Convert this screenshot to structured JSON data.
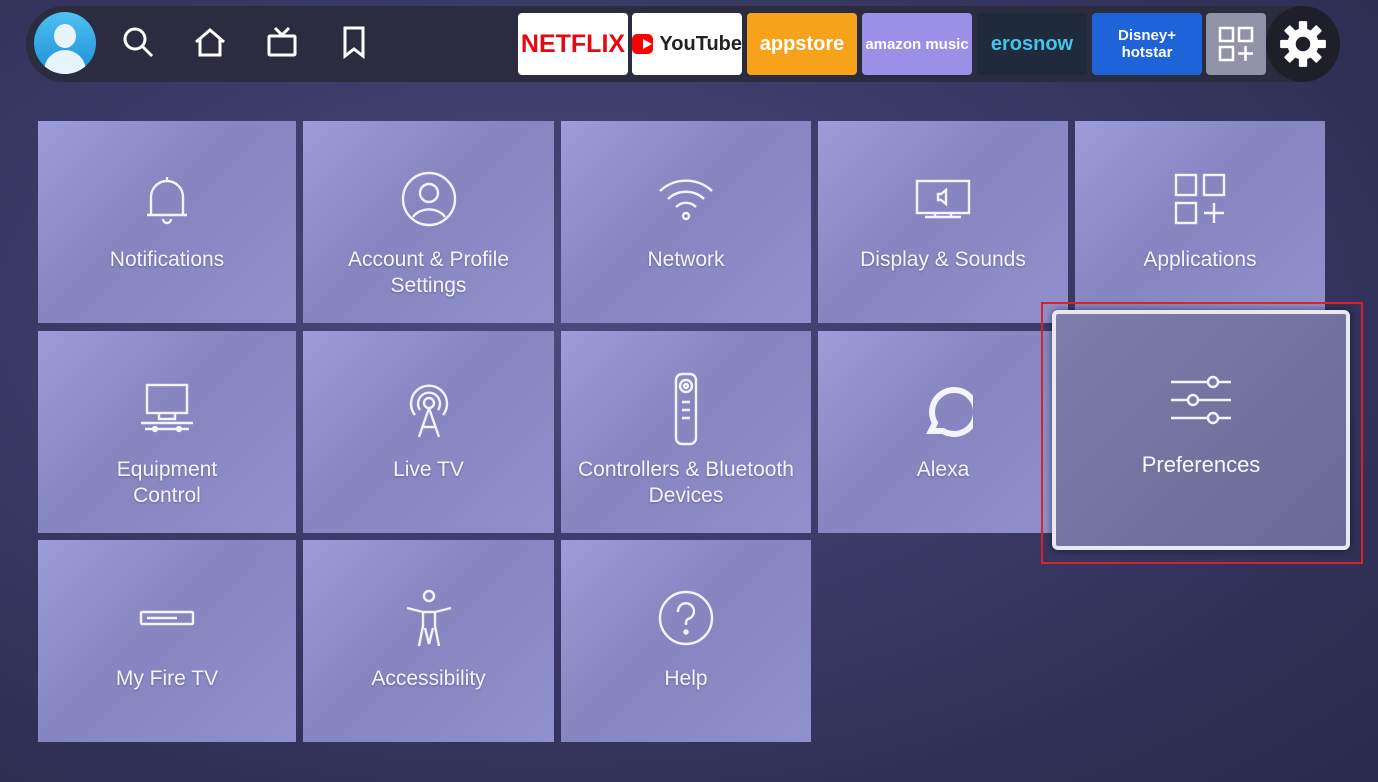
{
  "topbar": {
    "profile": {
      "icon": "user-profile-icon"
    },
    "nav_icons": [
      {
        "name": "search-icon"
      },
      {
        "name": "home-icon"
      },
      {
        "name": "live-tv-icon"
      },
      {
        "name": "bookmark-icon"
      }
    ],
    "apps": [
      {
        "label": "NETFLIX",
        "bg": "#ffffff",
        "color": "#e50914"
      },
      {
        "label": "YouTube",
        "bg": "#ffffff",
        "color": "#222222"
      },
      {
        "label": "appstore",
        "bg": "#f7a21b",
        "color": "#ffffff"
      },
      {
        "label": "amazon music",
        "bg": "#9b8fe8",
        "color": "#ffffff"
      },
      {
        "label": "erosnow",
        "bg": "#1f2a3c",
        "color": "#46c3e8"
      },
      {
        "label": "Disney+ hotstar",
        "bg": "#1e64d8",
        "color": "#ffffff"
      }
    ],
    "all_apps": {
      "icon": "all-apps-icon"
    },
    "settings": {
      "icon": "gear-icon"
    }
  },
  "settings": {
    "tiles": [
      {
        "label": "Notifications",
        "icon": "bell-icon"
      },
      {
        "label": "Account & Profile Settings",
        "icon": "account-icon"
      },
      {
        "label": "Network",
        "icon": "wifi-icon"
      },
      {
        "label": "Display & Sounds",
        "icon": "display-icon"
      },
      {
        "label": "Applications",
        "icon": "applications-icon"
      },
      {
        "label": "Equipment Control",
        "icon": "equipment-icon"
      },
      {
        "label": "Live TV",
        "icon": "antenna-icon"
      },
      {
        "label": "Controllers & Bluetooth Devices",
        "icon": "remote-icon"
      },
      {
        "label": "Alexa",
        "icon": "alexa-icon"
      },
      {
        "label": "Preferences",
        "icon": "sliders-icon",
        "selected": true
      },
      {
        "label": "My Fire TV",
        "icon": "firetv-stick-icon"
      },
      {
        "label": "Accessibility",
        "icon": "accessibility-icon"
      },
      {
        "label": "Help",
        "icon": "help-icon"
      }
    ]
  },
  "colors": {
    "highlight": "#d6242c"
  }
}
